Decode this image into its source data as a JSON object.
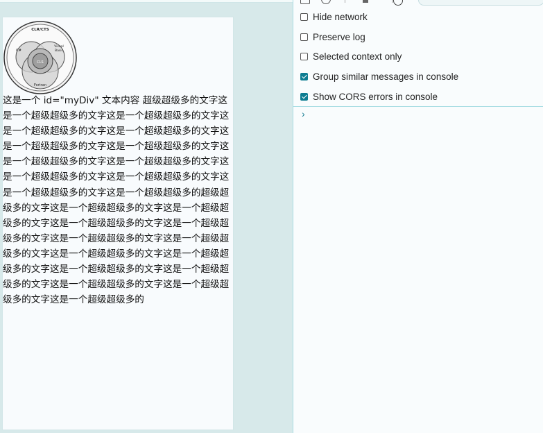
{
  "page": {
    "logo": {
      "title": "CLR/CTS",
      "c_sharp": "C#",
      "visual_basic_line1": "Visual",
      "visual_basic_line2": "Basic",
      "cls": "CLS",
      "fortran": "Fortran"
    },
    "div_text": "这是一个 id=\"myDiv\" 文本内容 超级超级多的文字这是一个超级超级多的文字这是一个超级超级多的文字这是一个超级超级多的文字这是一个超级超级多的文字这是一个超级超级多的文字这是一个超级超级多的文字这是一个超级超级多的文字这是一个超级超级多的文字这是一个超级超级多的文字这是一个超级超级多的文字这是一个超级超级多的文字这是一个超级超级多的超级超级多的文字这是一个超级超级多的文字这是一个超级超级多的文字这是一个超级超级多的文字这是一个超级超级多的文字这是一个超级超级多的文字这是一个超级超级多的文字这是一个超级超级多的文字这是一个超级超级多的文字这是一个超级超级多的文字这是一个超级超级多的文字这是一个超级超级多的文字这是一个超级超级多的文字这是一个超级超级多的"
  },
  "devtools": {
    "settings": [
      {
        "label": "Hide network",
        "checked": false
      },
      {
        "label": "Preserve log",
        "checked": false
      },
      {
        "label": "Selected context only",
        "checked": false
      },
      {
        "label": "Group similar messages in console",
        "checked": true
      },
      {
        "label": "Show CORS errors in console",
        "checked": true
      }
    ],
    "prompt_symbol": "›",
    "accent_color": "#0e7d92"
  }
}
